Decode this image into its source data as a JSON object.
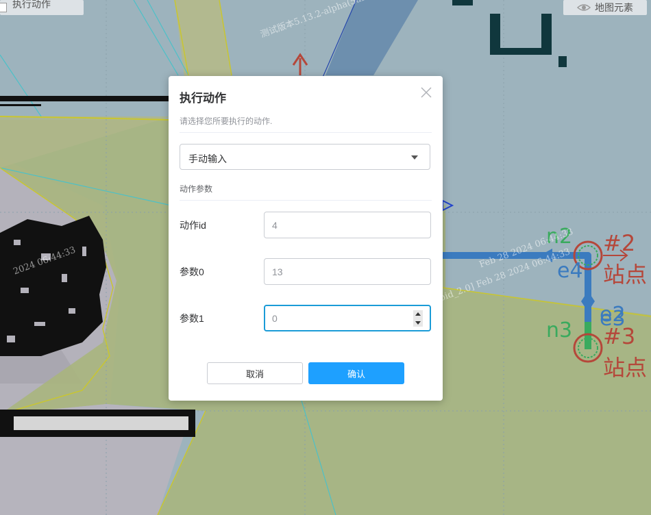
{
  "toolbar": {
    "execute_action_label": "执行动作",
    "map_elements_label": "地图元素"
  },
  "map": {
    "nodes": [
      {
        "id": "n2",
        "station_number": "#2",
        "station_label": "站点"
      },
      {
        "id": "n3",
        "station_number": "#3",
        "station_label": "站点"
      }
    ],
    "edges": [
      "e4",
      "e2",
      "e3"
    ],
    "watermarks": [
      "测试版本5.13.2-alpha(5afc17e)",
      "测试版本5.13.2-alpha(5afc17e)[test_oba_avoid_2.0] Feb 28 2024 06:44:33",
      "2024 06:44:33",
      "Feb 28 2024 06:44:33"
    ],
    "colors": {
      "background": "#9db3bd",
      "zone_fill": "#a9b57e",
      "route": "#3b7bbf",
      "node_green": "#3aaa5e",
      "station_red": "#b5473a"
    }
  },
  "dialog": {
    "title": "执行动作",
    "hint": "请选择您所要执行的动作.",
    "action_select": {
      "value": "手动输入"
    },
    "section_label": "动作参数",
    "fields": [
      {
        "label": "动作id",
        "placeholder": "4"
      },
      {
        "label": "参数0",
        "placeholder": "13"
      },
      {
        "label": "参数1",
        "placeholder": "0"
      }
    ],
    "cancel_label": "取消",
    "confirm_label": "确认",
    "colors": {
      "primary": "#1ea0ff",
      "focus_border": "#1a9bd7"
    }
  }
}
